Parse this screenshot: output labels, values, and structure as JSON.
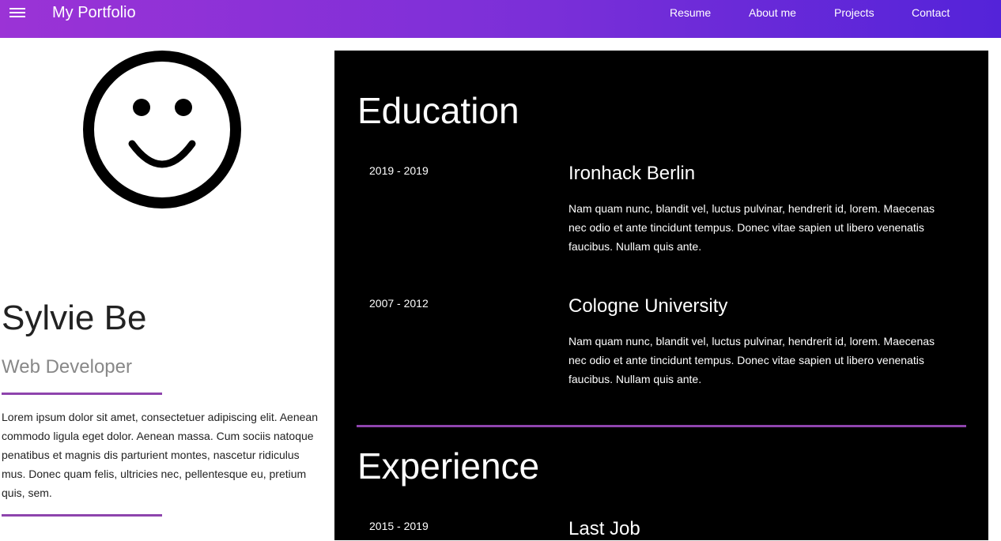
{
  "header": {
    "brand": "My Portfolio",
    "nav": [
      "Resume",
      "About me",
      "Projects",
      "Contact"
    ]
  },
  "profile": {
    "avatar_icon": "smiley-face-icon",
    "name": "Sylvie Be",
    "role": "Web Developer",
    "bio": "Lorem ipsum dolor sit amet, consectetuer adipiscing elit. Aenean commodo ligula eget dolor. Aenean massa. Cum sociis natoque penatibus et magnis dis parturient montes, nascetur ridiculus mus. Donec quam felis, ultricies nec, pellentesque eu, pretium quis, sem."
  },
  "education": {
    "title": "Education",
    "entries": [
      {
        "period": "2019 - 2019",
        "title": "Ironhack Berlin",
        "description": "Nam quam nunc, blandit vel, luctus pulvinar, hendrerit id, lorem. Maecenas nec odio et ante tincidunt tempus. Donec vitae sapien ut libero venenatis faucibus. Nullam quis ante."
      },
      {
        "period": "2007 - 2012",
        "title": "Cologne University",
        "description": "Nam quam nunc, blandit vel, luctus pulvinar, hendrerit id, lorem. Maecenas nec odio et ante tincidunt tempus. Donec vitae sapien ut libero venenatis faucibus. Nullam quis ante."
      }
    ]
  },
  "experience": {
    "title": "Experience",
    "entries": [
      {
        "period": "2015 - 2019",
        "title": "Last Job"
      }
    ]
  },
  "colors": {
    "header_gradient_start": "#9b33d6",
    "header_gradient_end": "#5423d9",
    "accent": "#8e44ad",
    "panel_background": "#000000"
  }
}
